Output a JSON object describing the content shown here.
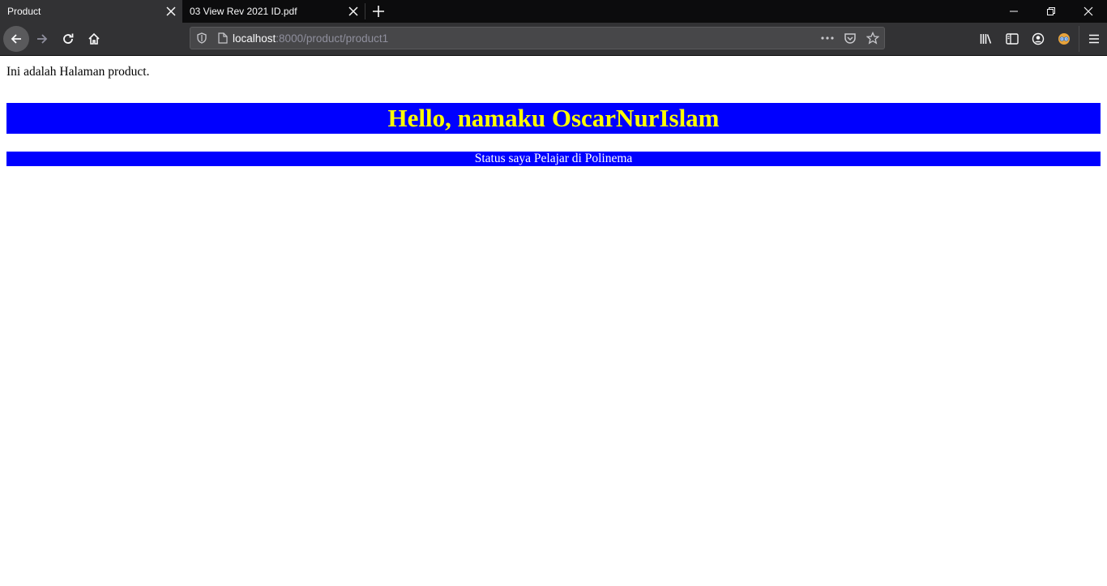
{
  "browser": {
    "tabs": [
      {
        "title": "Product",
        "active": true
      },
      {
        "title": "03 View Rev 2021 ID.pdf",
        "active": false
      }
    ],
    "url": {
      "host": "localhost",
      "rest": ":8000/product/product1"
    }
  },
  "page": {
    "intro": "Ini adalah Halaman product.",
    "heading": "Hello, namaku OscarNurIslam",
    "status": "Status saya Pelajar di Polinema",
    "colors": {
      "banner_bg": "#0000ff",
      "heading_text": "#ffff00",
      "status_text": "#ffffff"
    }
  }
}
